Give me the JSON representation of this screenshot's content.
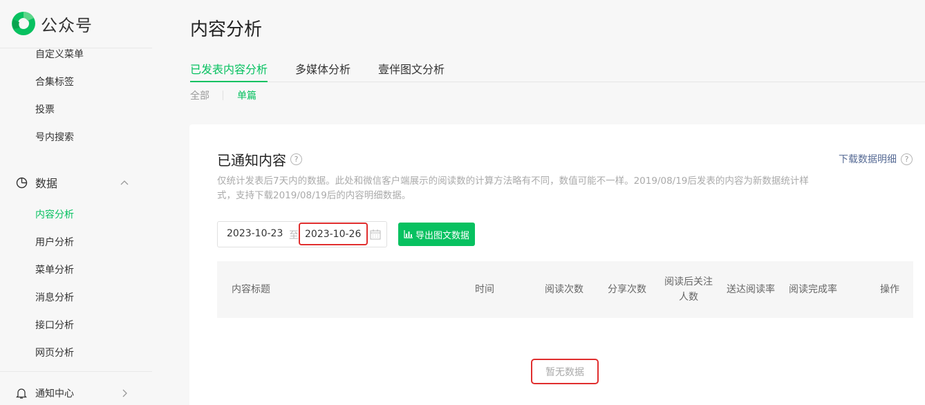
{
  "brand": {
    "name": "公众号"
  },
  "sidebar": {
    "top_items": [
      "自定义菜单",
      "合集标签",
      "投票",
      "号内搜索"
    ],
    "data_group": {
      "label": "数据",
      "expanded": true
    },
    "data_items": [
      {
        "label": "内容分析",
        "active": true
      },
      {
        "label": "用户分析",
        "active": false
      },
      {
        "label": "菜单分析",
        "active": false
      },
      {
        "label": "消息分析",
        "active": false
      },
      {
        "label": "接口分析",
        "active": false
      },
      {
        "label": "网页分析",
        "active": false
      }
    ],
    "notify_group": {
      "label": "通知中心"
    }
  },
  "page": {
    "title": "内容分析"
  },
  "tabs": [
    "已发表内容分析",
    "多媒体分析",
    "壹伴图文分析"
  ],
  "active_tab": "已发表内容分析",
  "subtabs": [
    "全部",
    "单篇"
  ],
  "active_subtab": "单篇",
  "card": {
    "title": "已通知内容",
    "download_label": "下载数据明细",
    "description": "仅统计发表后7天内的数据。此处和微信客户端展示的阅读数的计算方法略有不同，数值可能不一样。2019/08/19后发表的内容为新数据统计样式，支持下载2019/08/19后的内容明细数据。",
    "date_start": "2023-10-23",
    "date_sep": "至",
    "date_end": "2023-10-26",
    "export_label": "导出图文数据",
    "columns": [
      "内容标题",
      "时间",
      "阅读次数",
      "分享次数",
      "阅读后关注人数",
      "送达阅读率",
      "阅读完成率",
      "操作"
    ],
    "empty_text": "暂无数据"
  },
  "colors": {
    "accent": "#07c160",
    "link": "#576b95",
    "highlight": "#e02e2e"
  }
}
